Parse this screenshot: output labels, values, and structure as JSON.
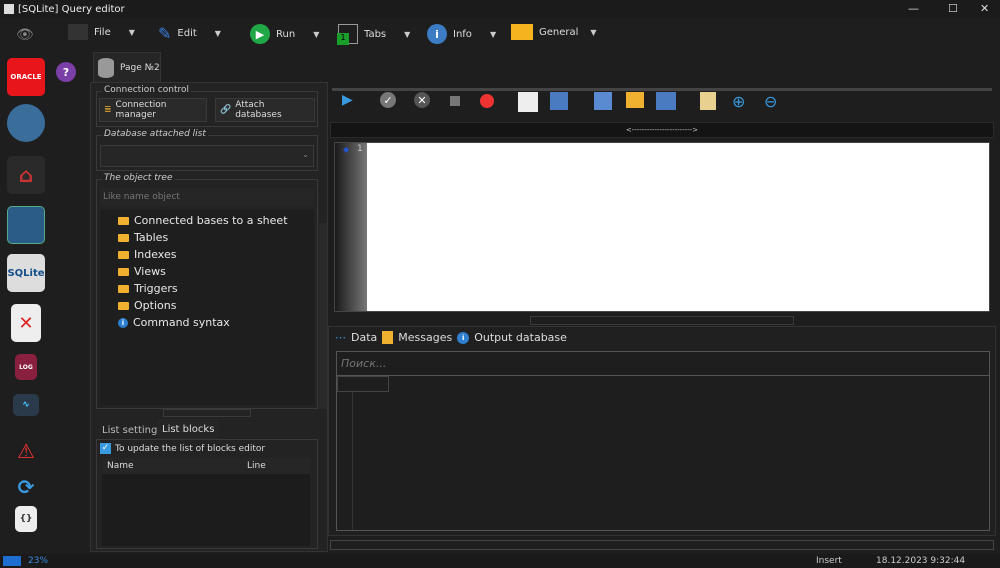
{
  "window": {
    "title": "[SQLite] Query editor",
    "minimize": "—",
    "maximize": "☐",
    "close": "✕"
  },
  "toolbar": {
    "file": "File",
    "edit": "Edit",
    "run": "Run",
    "tabs": "Tabs",
    "tabs_badge": "1",
    "info": "Info",
    "general": "General"
  },
  "sidebar": {
    "oracle": "ORACLE",
    "help": "?",
    "sqlite": "SQLite",
    "log": "LOG"
  },
  "page_tab": {
    "label": "Page №2"
  },
  "connection": {
    "group_label": "Connection control",
    "manager": "Connection manager",
    "attach": "Attach databases"
  },
  "attached": {
    "group_label": "Database attached list",
    "value": ""
  },
  "object_tree": {
    "group_label": "The object tree",
    "filter_placeholder": "Like name object",
    "items": [
      {
        "label": "Connected bases to a sheet",
        "icon": "folder"
      },
      {
        "label": "Tables",
        "icon": "folder"
      },
      {
        "label": "Indexes",
        "icon": "folder"
      },
      {
        "label": "Views",
        "icon": "folder"
      },
      {
        "label": "Triggers",
        "icon": "folder"
      },
      {
        "label": "Options",
        "icon": "folder"
      },
      {
        "label": "Command syntax",
        "icon": "info"
      }
    ]
  },
  "bottom_tabs": {
    "settings": "List settings",
    "blocks": "List blocks",
    "checkbox": "To update the list of blocks editor",
    "checked": true,
    "col_name": "Name",
    "col_line": "Line"
  },
  "editor": {
    "splitter": "<------------------------>",
    "line_number": "1",
    "content": ""
  },
  "results": {
    "tab_data": "Data",
    "tab_messages": "Messages",
    "tab_output": "Output database",
    "search_placeholder": "Поиск..."
  },
  "status": {
    "progress_percent": 23,
    "progress_label": "23%",
    "mode": "Insert",
    "datetime": "18.12.2023 9:32:44"
  },
  "colors": {
    "accent": "#2f7fd0",
    "run_green": "#1fa845",
    "oracle_red": "#e8151b",
    "help_purple": "#7b3fa8"
  }
}
